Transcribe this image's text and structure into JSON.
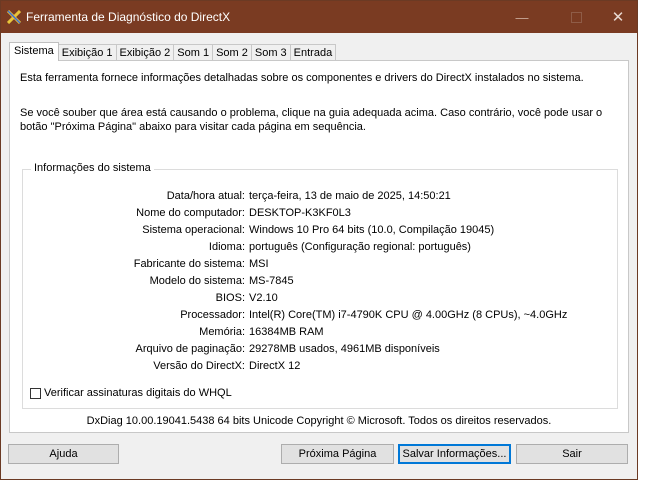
{
  "window": {
    "title": "Ferramenta de Diagnóstico do DirectX",
    "controls": {
      "minimize": "—",
      "maximize": "",
      "close": "✕"
    }
  },
  "tabs": [
    {
      "label": "Sistema",
      "active": true
    },
    {
      "label": "Exibição 1",
      "active": false
    },
    {
      "label": "Exibição 2",
      "active": false
    },
    {
      "label": "Som 1",
      "active": false
    },
    {
      "label": "Som 2",
      "active": false
    },
    {
      "label": "Som 3",
      "active": false
    },
    {
      "label": "Entrada",
      "active": false
    }
  ],
  "intro": {
    "line1": "Esta ferramenta fornece informações detalhadas sobre os componentes e drivers do DirectX instalados no sistema.",
    "line2": "Se você souber que área está causando o problema, clique na guia adequada acima. Caso contrário, você pode usar o botão \"Próxima Página\" abaixo para visitar cada página em sequência."
  },
  "system_info": {
    "legend": "Informações do sistema",
    "rows": [
      {
        "label": "Data/hora atual:",
        "value": "terça-feira, 13 de maio de 2025, 14:50:21"
      },
      {
        "label": "Nome do computador:",
        "value": "DESKTOP-K3KF0L3"
      },
      {
        "label": "Sistema operacional:",
        "value": "Windows 10 Pro 64 bits (10.0, Compilação 19045)"
      },
      {
        "label": "Idioma:",
        "value": "português (Configuração regional: português)"
      },
      {
        "label": "Fabricante do sistema:",
        "value": "MSI"
      },
      {
        "label": "Modelo do sistema:",
        "value": "MS-7845"
      },
      {
        "label": "BIOS:",
        "value": "V2.10"
      },
      {
        "label": "Processador:",
        "value": "Intel(R) Core(TM) i7-4790K CPU @ 4.00GHz (8 CPUs), ~4.0GHz"
      },
      {
        "label": "Memória:",
        "value": "16384MB RAM"
      },
      {
        "label": "Arquivo de paginação:",
        "value": "29278MB usados, 4961MB disponíveis"
      },
      {
        "label": "Versão do DirectX:",
        "value": "DirectX 12"
      }
    ]
  },
  "whql_checkbox": {
    "label": "Verificar assinaturas digitais do WHQL",
    "checked": false
  },
  "footer": "DxDiag 10.00.19041.5438 64 bits Unicode  Copyright © Microsoft. Todos os direitos reservados.",
  "buttons": {
    "help": "Ajuda",
    "next": "Próxima Página",
    "save": "Salvar Informações...",
    "exit": "Sair"
  },
  "colors": {
    "titlebar": "#7a3b22",
    "default_button_border": "#0078d7"
  },
  "icons": {
    "app": "directx-icon"
  }
}
